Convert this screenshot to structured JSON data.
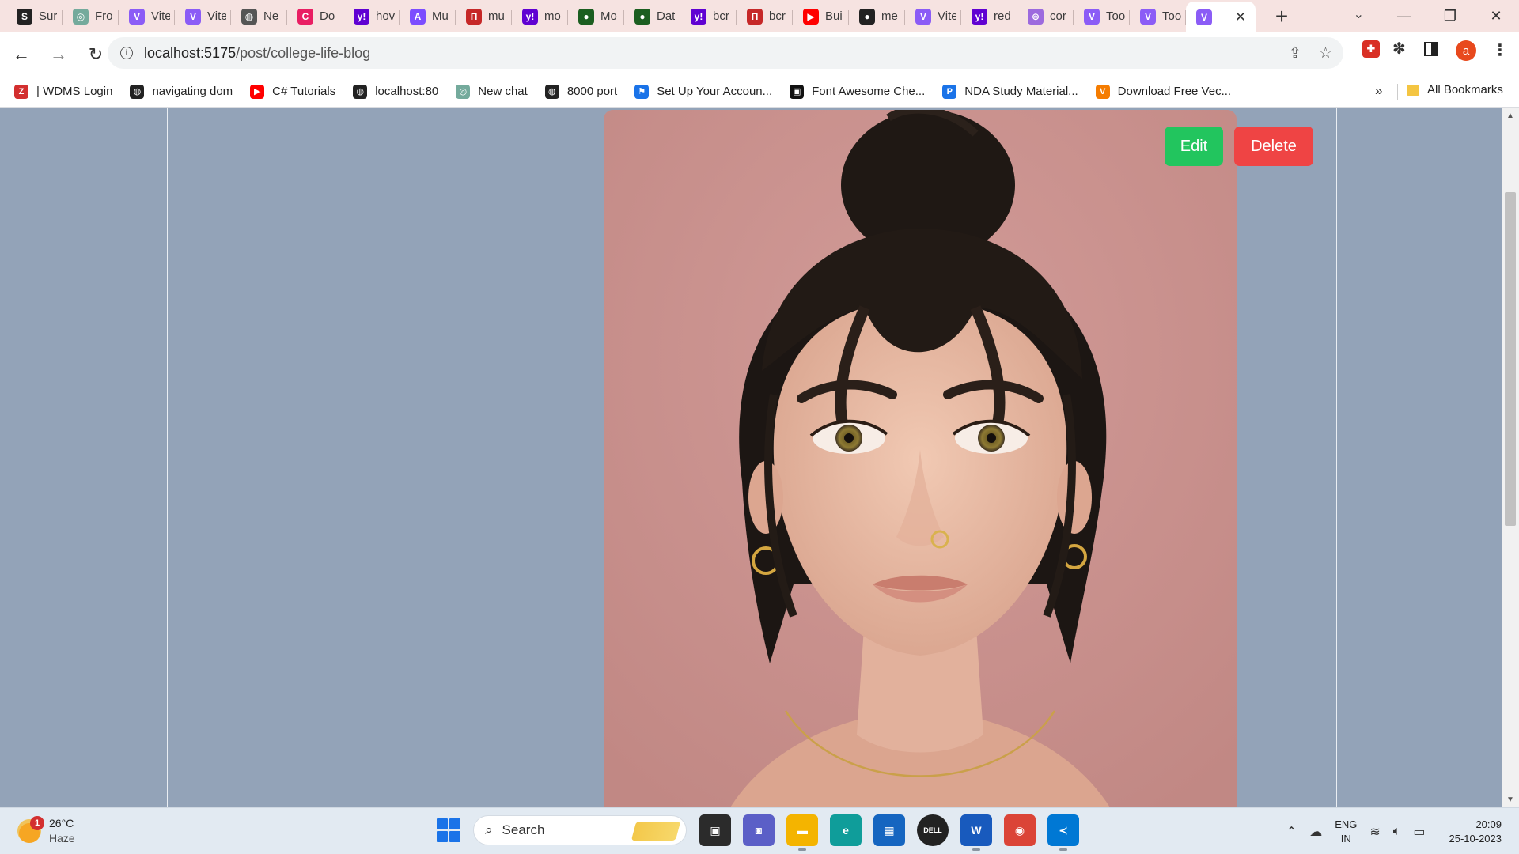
{
  "tabs": [
    {
      "title": "Sur",
      "icon": "app-icon",
      "color": "#222222",
      "glyph": "S"
    },
    {
      "title": "Fro",
      "icon": "chatgpt-icon",
      "color": "#74aa9c",
      "glyph": "◎"
    },
    {
      "title": "Vite",
      "icon": "vite-icon",
      "color": "#8b5cf6",
      "glyph": "V"
    },
    {
      "title": "Vite",
      "icon": "vite-icon",
      "color": "#8b5cf6",
      "glyph": "V"
    },
    {
      "title": "Ne",
      "icon": "globe-icon",
      "color": "#555555",
      "glyph": "◍"
    },
    {
      "title": "Do",
      "icon": "app-icon",
      "color": "#e91e63",
      "glyph": "C"
    },
    {
      "title": "hov",
      "icon": "yahoo-icon",
      "color": "#6001d2",
      "glyph": "y!"
    },
    {
      "title": "Mu",
      "icon": "app-icon",
      "color": "#7c4dff",
      "glyph": "A"
    },
    {
      "title": "mu",
      "icon": "app-icon",
      "color": "#c62828",
      "glyph": "П"
    },
    {
      "title": "mo",
      "icon": "yahoo-icon",
      "color": "#6001d2",
      "glyph": "y!"
    },
    {
      "title": "Mo",
      "icon": "mongodb-icon",
      "color": "#1b5e20",
      "glyph": "●"
    },
    {
      "title": "Dat",
      "icon": "mongodb-icon",
      "color": "#1b5e20",
      "glyph": "●"
    },
    {
      "title": "bcr",
      "icon": "yahoo-icon",
      "color": "#6001d2",
      "glyph": "y!"
    },
    {
      "title": "bcr",
      "icon": "app-icon",
      "color": "#c62828",
      "glyph": "П"
    },
    {
      "title": "Bui",
      "icon": "youtube-icon",
      "color": "#ff0000",
      "glyph": "▶"
    },
    {
      "title": "me",
      "icon": "github-icon",
      "color": "#222222",
      "glyph": "●"
    },
    {
      "title": "Vite",
      "icon": "vite-icon",
      "color": "#8b5cf6",
      "glyph": "V"
    },
    {
      "title": "red",
      "icon": "yahoo-icon",
      "color": "#6001d2",
      "glyph": "y!"
    },
    {
      "title": "cor",
      "icon": "app-icon",
      "color": "#9c6ade",
      "glyph": "⊛"
    },
    {
      "title": "Too",
      "icon": "vite-icon",
      "color": "#8b5cf6",
      "glyph": "V"
    },
    {
      "title": "Too",
      "icon": "vite-icon",
      "color": "#8b5cf6",
      "glyph": "V"
    }
  ],
  "active_tab": {
    "icon": "vite-icon",
    "glyph": "V",
    "color": "#8b5cf6",
    "close": "✕"
  },
  "new_tab": "+",
  "window_controls": {
    "minimize": "—",
    "restore": "❐",
    "close": "✕",
    "tab_search": "⌄"
  },
  "toolbar": {
    "back": "←",
    "forward": "→",
    "reload": "↻",
    "url_host": "localhost:5175",
    "url_path": "/post/college-life-blog",
    "avatar_letter": "a"
  },
  "bookmarks": [
    {
      "label": "| WDMS Login",
      "icon": "wdms-icon",
      "color": "#d32f2f",
      "glyph": "Z"
    },
    {
      "label": "navigating dom",
      "icon": "globe-icon",
      "color": "#222222",
      "glyph": "◍"
    },
    {
      "label": "C# Tutorials",
      "icon": "youtube-icon",
      "color": "#ff0000",
      "glyph": "▶"
    },
    {
      "label": "localhost:80",
      "icon": "globe-icon",
      "color": "#222222",
      "glyph": "◍"
    },
    {
      "label": "New chat",
      "icon": "chatgpt-icon",
      "color": "#74aa9c",
      "glyph": "◎"
    },
    {
      "label": "8000 port",
      "icon": "globe-icon",
      "color": "#222222",
      "glyph": "◍"
    },
    {
      "label": "Set Up Your Accoun...",
      "icon": "flag-icon",
      "color": "#1a73e8",
      "glyph": "⚑"
    },
    {
      "label": "Font Awesome Che...",
      "icon": "font-awesome-icon",
      "color": "#111111",
      "glyph": "▣"
    },
    {
      "label": "NDA Study Material...",
      "icon": "pdf-icon",
      "color": "#1a73e8",
      "glyph": "P"
    },
    {
      "label": "Download Free Vec...",
      "icon": "vecteezy-icon",
      "color": "#f57c00",
      "glyph": "V"
    }
  ],
  "bookmarks_more": "»",
  "all_bookmarks": "All Bookmarks",
  "post": {
    "edit_label": "Edit",
    "delete_label": "Delete",
    "image_alt": "portrait-photo"
  },
  "scrollbar": {
    "up": "▲",
    "down": "▼"
  },
  "taskbar": {
    "weather_temp": "26°C",
    "weather_cond": "Haze",
    "weather_badge": "1",
    "search_label": "Search",
    "lang_1": "ENG",
    "lang_2": "IN",
    "time": "20:09",
    "date": "25-10-2023",
    "apps": [
      {
        "name": "task-view-icon",
        "color": "#2b2b2b",
        "glyph": "▣",
        "state": ""
      },
      {
        "name": "teams-chat-icon",
        "color": "#5b5fc7",
        "glyph": "◙",
        "state": ""
      },
      {
        "name": "file-explorer-icon",
        "color": "#f4b400",
        "glyph": "▬",
        "state": "running"
      },
      {
        "name": "edge-icon",
        "color": "#0f9d9a",
        "glyph": "e",
        "state": ""
      },
      {
        "name": "microsoft-store-icon",
        "color": "#1565c0",
        "glyph": "▦",
        "state": ""
      },
      {
        "name": "dell-icon",
        "color": "#222222",
        "glyph": "DELL",
        "state": ""
      },
      {
        "name": "word-icon",
        "color": "#185abd",
        "glyph": "W",
        "state": "running"
      },
      {
        "name": "chrome-icon",
        "color": "#db4437",
        "glyph": "◉",
        "state": "active"
      },
      {
        "name": "vscode-icon",
        "color": "#0078d4",
        "glyph": "≺",
        "state": "running"
      }
    ]
  }
}
